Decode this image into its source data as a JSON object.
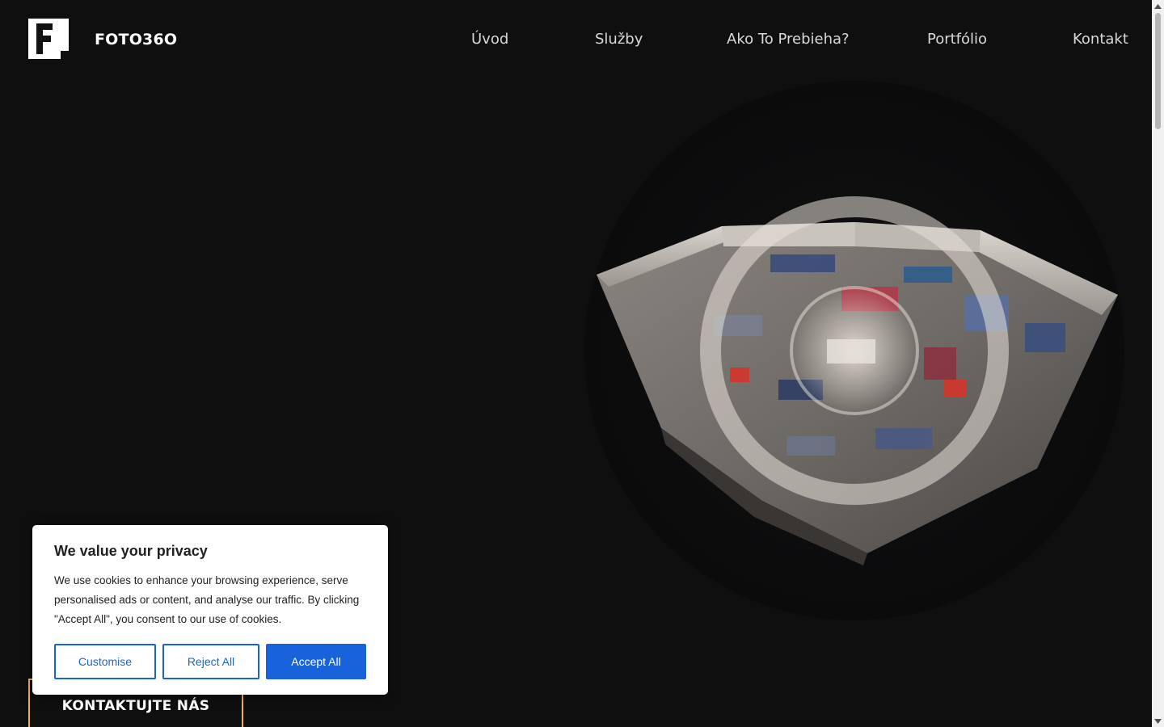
{
  "header": {
    "logo_text": "FOTO36O",
    "nav": [
      {
        "label": "Úvod"
      },
      {
        "label": "Služby"
      },
      {
        "label": "Ako To Prebieha?"
      },
      {
        "label": "Portfólio"
      },
      {
        "label": "Kontakt"
      }
    ]
  },
  "hero": {
    "image_icon": "dollhouse-3d-store-model"
  },
  "cta": {
    "label": "KONTAKTUJTE NÁS"
  },
  "cookie_banner": {
    "title": "We value your privacy",
    "text": "We use cookies to enhance your browsing experience, serve personalised ads or content, and analyse our traffic. By clicking \"Accept All\", you consent to our use of cookies.",
    "buttons": {
      "customise": "Customise",
      "reject": "Reject All",
      "accept": "Accept All"
    }
  },
  "colors": {
    "background": "#0f0f10",
    "accent": "#f2b447",
    "cookie_primary": "#1863dc"
  }
}
